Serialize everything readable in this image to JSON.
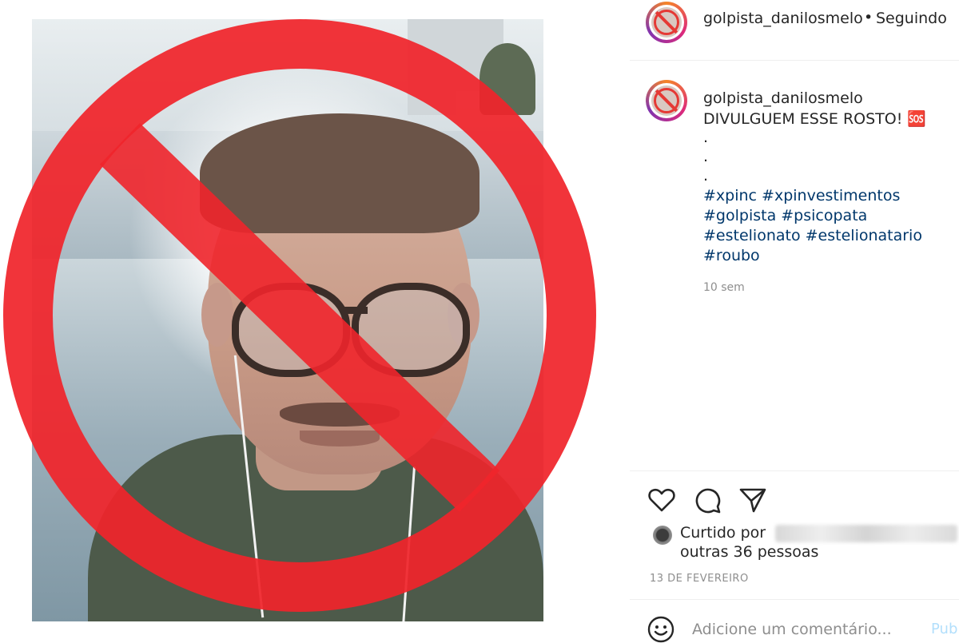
{
  "header": {
    "username": "golpista_danilosmelo",
    "separator": "•",
    "follow_status": "Seguindo"
  },
  "caption": {
    "username": "golpista_danilosmelo",
    "text": "DIVULGUEM ESSE ROSTO! 🆘",
    "dots": [
      ".",
      ".",
      "."
    ],
    "hashtags": [
      "#xpinc",
      "#xpinvestimentos",
      "#golpista",
      "#psicopata",
      "#estelionato",
      "#estelionatario",
      "#roubo"
    ],
    "time_ago": "10 sem"
  },
  "actions": {
    "like_icon": "heart-icon",
    "comment_icon": "comment-icon",
    "share_icon": "share-icon"
  },
  "likes": {
    "prefix": "Curtido por",
    "suffix": "outras 36 pessoas"
  },
  "post_date": "13 DE FEVEREIRO",
  "comment": {
    "placeholder": "Adicione um comentário...",
    "publish_label": "Pub"
  },
  "colors": {
    "ban_red": "#f0252b",
    "hashtag_blue": "#00376b",
    "muted_gray": "#8e8e8e",
    "publish_blue": "#b2dffc"
  }
}
